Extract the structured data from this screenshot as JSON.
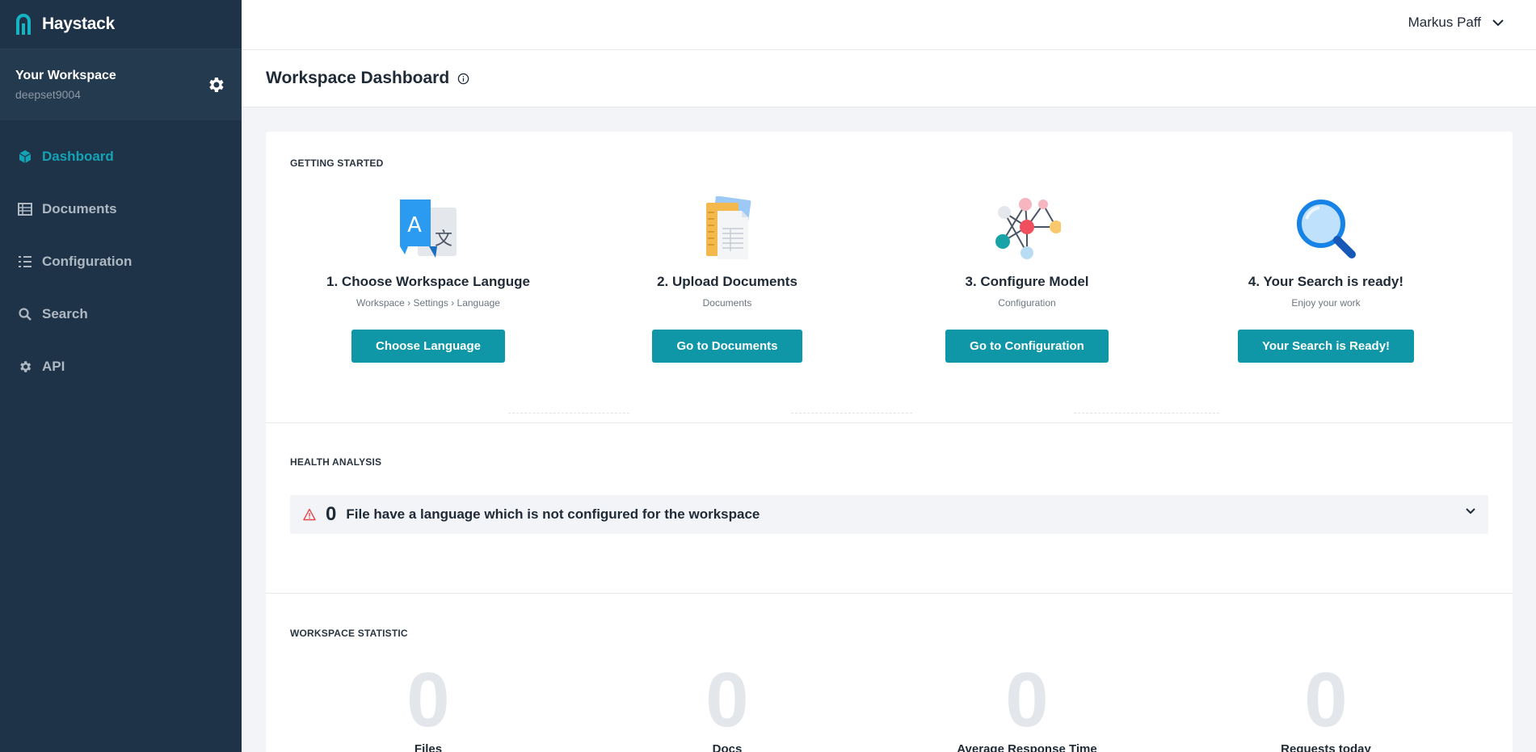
{
  "brand": {
    "name": "Haystack"
  },
  "workspace": {
    "title": "Your Workspace",
    "subtitle": "deepset9004"
  },
  "nav": [
    {
      "label": "Dashboard",
      "icon": "cube-icon",
      "active": true
    },
    {
      "label": "Documents",
      "icon": "table-icon"
    },
    {
      "label": "Configuration",
      "icon": "list-settings-icon"
    },
    {
      "label": "Search",
      "icon": "search-icon"
    },
    {
      "label": "API",
      "icon": "gear-icon"
    }
  ],
  "header": {
    "user_name": "Markus Paff"
  },
  "page": {
    "title": "Workspace Dashboard"
  },
  "getting_started": {
    "label": "GETTING STARTED",
    "steps": [
      {
        "title": "1. Choose Workspace Languge",
        "subtitle": "Workspace › Settings › Language",
        "button": "Choose Language",
        "icon": "translate-icon"
      },
      {
        "title": "2. Upload Documents",
        "subtitle": "Documents",
        "button": "Go to Documents",
        "icon": "documents-icon"
      },
      {
        "title": "3. Configure Model",
        "subtitle": "Configuration",
        "button": "Go to Configuration",
        "icon": "network-model-icon"
      },
      {
        "title": "4. Your Search is ready!",
        "subtitle": "Enjoy your work",
        "button": "Your Search is Ready!",
        "icon": "magnifier-icon"
      }
    ]
  },
  "health": {
    "label": "HEALTH ANALYSIS",
    "count": "0",
    "text": "File have a language which is not configured for the workspace"
  },
  "statistic": {
    "label": "WORKSPACE STATISTIC",
    "items": [
      {
        "value": "0",
        "label": "Files"
      },
      {
        "value": "0",
        "label": "Docs"
      },
      {
        "value": "0",
        "label": "Average Response Time"
      },
      {
        "value": "0",
        "label": "Requests today"
      }
    ]
  },
  "colors": {
    "sidebar": "#1e3347",
    "accent": "#0f97a7",
    "active_nav": "#14a3b4"
  }
}
